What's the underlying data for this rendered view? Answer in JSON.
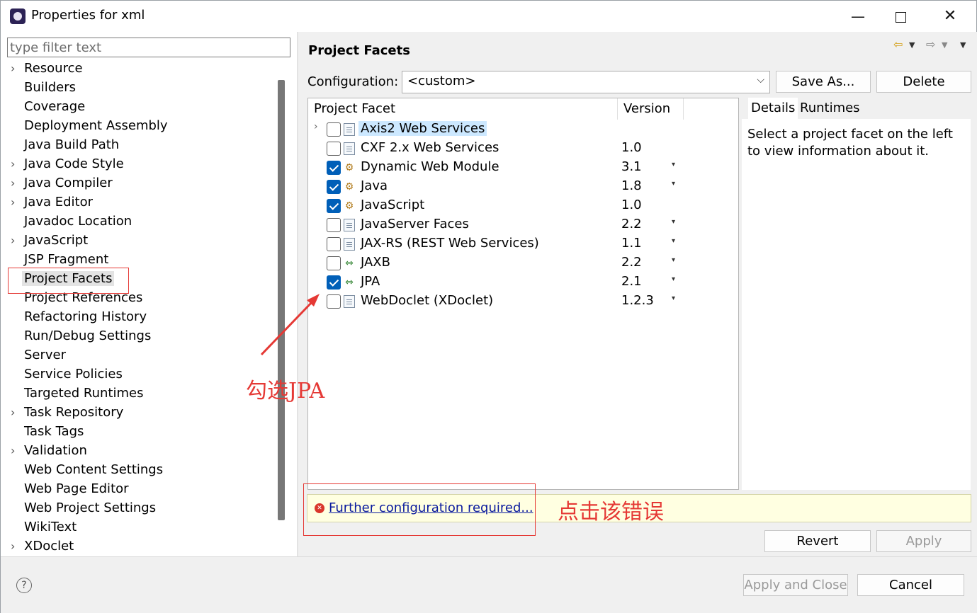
{
  "window": {
    "title": "Properties for xml"
  },
  "filter": {
    "placeholder": "type filter text"
  },
  "tree": [
    {
      "label": "Resource",
      "expandable": true
    },
    {
      "label": "Builders",
      "expandable": false
    },
    {
      "label": "Coverage",
      "expandable": false
    },
    {
      "label": "Deployment Assembly",
      "expandable": false
    },
    {
      "label": "Java Build Path",
      "expandable": false
    },
    {
      "label": "Java Code Style",
      "expandable": true
    },
    {
      "label": "Java Compiler",
      "expandable": true
    },
    {
      "label": "Java Editor",
      "expandable": true
    },
    {
      "label": "Javadoc Location",
      "expandable": false
    },
    {
      "label": "JavaScript",
      "expandable": true
    },
    {
      "label": "JSP Fragment",
      "expandable": false
    },
    {
      "label": "Project Facets",
      "expandable": false,
      "selected": true
    },
    {
      "label": "Project References",
      "expandable": false
    },
    {
      "label": "Refactoring History",
      "expandable": false
    },
    {
      "label": "Run/Debug Settings",
      "expandable": false
    },
    {
      "label": "Server",
      "expandable": false
    },
    {
      "label": "Service Policies",
      "expandable": false
    },
    {
      "label": "Targeted Runtimes",
      "expandable": false
    },
    {
      "label": "Task Repository",
      "expandable": true
    },
    {
      "label": "Task Tags",
      "expandable": false
    },
    {
      "label": "Validation",
      "expandable": true
    },
    {
      "label": "Web Content Settings",
      "expandable": false
    },
    {
      "label": "Web Page Editor",
      "expandable": false
    },
    {
      "label": "Web Project Settings",
      "expandable": false
    },
    {
      "label": "WikiText",
      "expandable": false
    },
    {
      "label": "XDoclet",
      "expandable": true
    }
  ],
  "page": {
    "title": "Project Facets",
    "configuration_label": "Configuration:",
    "configuration_value": "<custom>",
    "save_as": "Save As...",
    "delete": "Delete"
  },
  "facets_table": {
    "headers": [
      "Project Facet",
      "Version"
    ],
    "rows": [
      {
        "name": "Axis2 Web Services",
        "version": "",
        "checked": false,
        "icon": "document-icon",
        "expandable": true,
        "highlight": true,
        "dropdown": false
      },
      {
        "name": "CXF 2.x Web Services",
        "version": "1.0",
        "checked": false,
        "icon": "document-icon",
        "dropdown": false
      },
      {
        "name": "Dynamic Web Module",
        "version": "3.1",
        "checked": true,
        "icon": "module-icon",
        "dropdown": true
      },
      {
        "name": "Java",
        "version": "1.8",
        "checked": true,
        "icon": "module-icon",
        "dropdown": true
      },
      {
        "name": "JavaScript",
        "version": "1.0",
        "checked": true,
        "icon": "module-icon",
        "dropdown": false
      },
      {
        "name": "JavaServer Faces",
        "version": "2.2",
        "checked": false,
        "icon": "document-icon",
        "dropdown": true
      },
      {
        "name": "JAX-RS (REST Web Services)",
        "version": "1.1",
        "checked": false,
        "icon": "document-icon",
        "dropdown": true
      },
      {
        "name": "JAXB",
        "version": "2.2",
        "checked": false,
        "icon": "swap-icon",
        "dropdown": true
      },
      {
        "name": "JPA",
        "version": "2.1",
        "checked": true,
        "icon": "swap-icon",
        "dropdown": true
      },
      {
        "name": "WebDoclet (XDoclet)",
        "version": "1.2.3",
        "checked": false,
        "icon": "document-icon",
        "dropdown": true
      }
    ]
  },
  "details": {
    "tabs": [
      "Details",
      "Runtimes"
    ],
    "text": "Select a project facet on the left to view information about it."
  },
  "message": {
    "text": "Further configuration required..."
  },
  "buttons": {
    "revert": "Revert",
    "apply": "Apply",
    "apply_and_close": "Apply and Close",
    "cancel": "Cancel"
  },
  "annotations": {
    "check_jpa": "勾选JPA",
    "click_error": "点击该错误",
    "color": "#e53935"
  }
}
